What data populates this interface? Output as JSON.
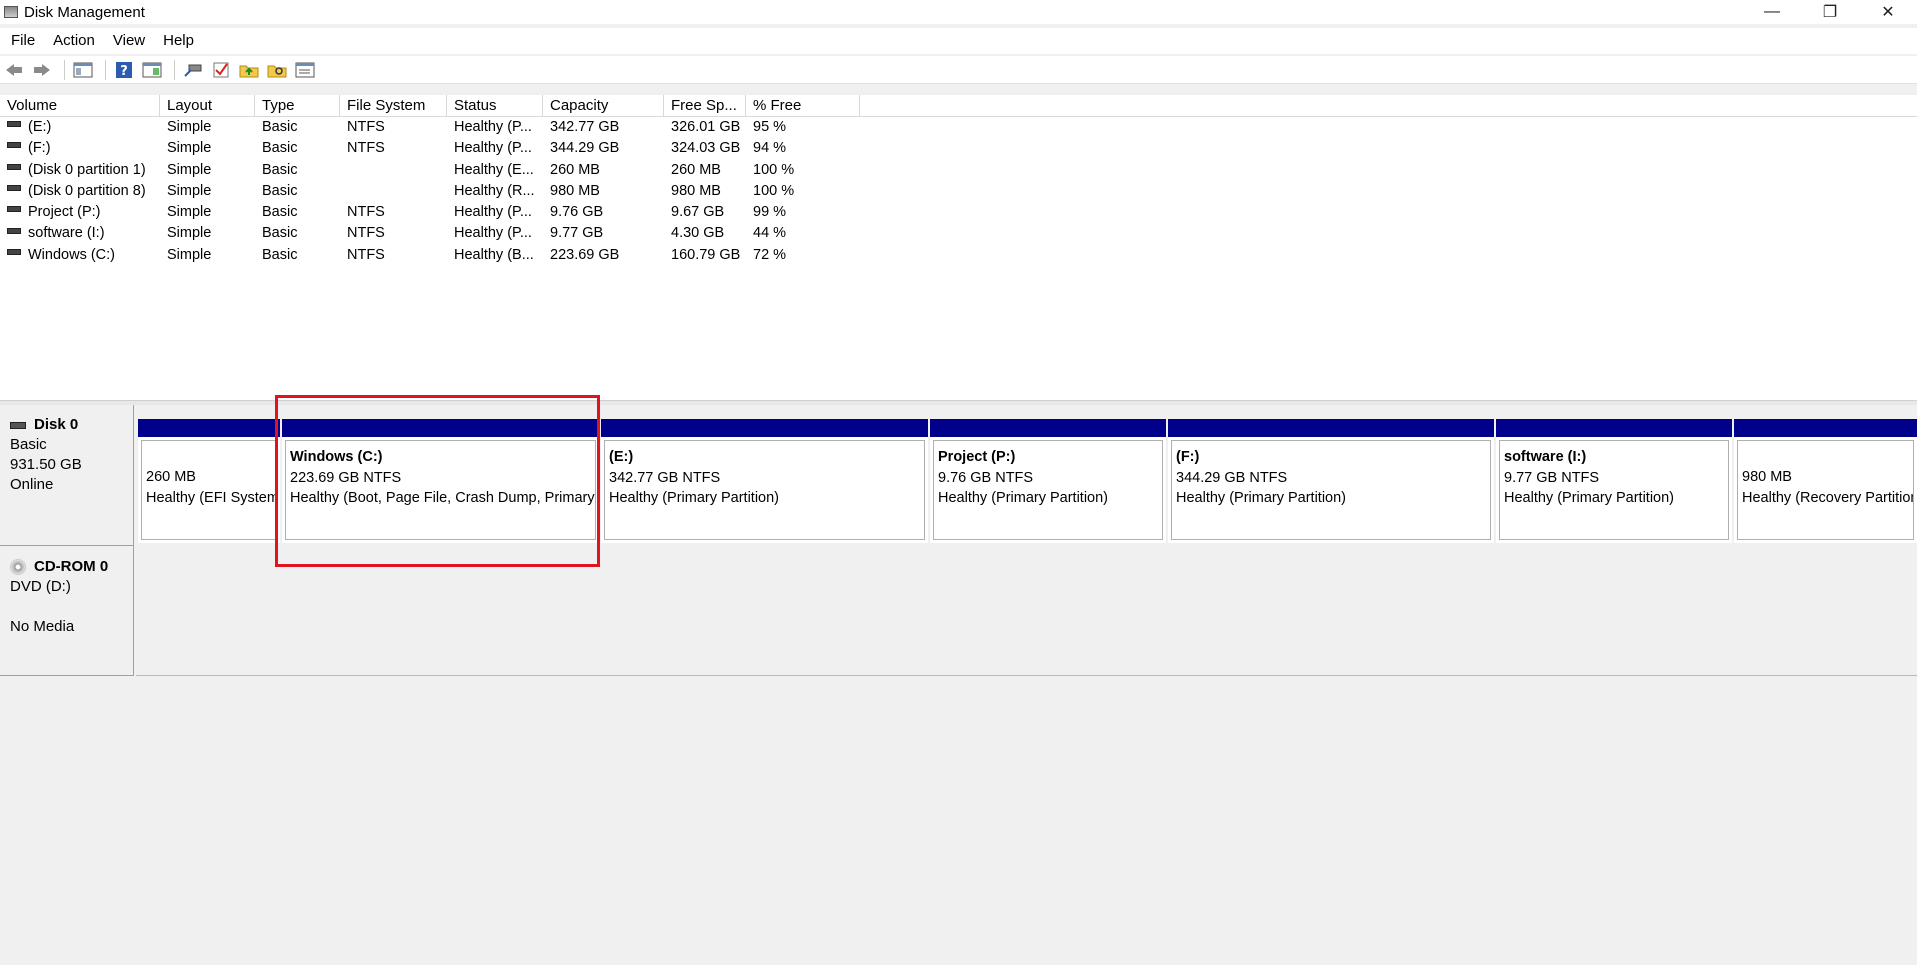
{
  "window": {
    "title": "Disk Management",
    "controls": [
      "—",
      "❐",
      "✕"
    ]
  },
  "menu": [
    "File",
    "Action",
    "View",
    "Help"
  ],
  "toolbar_icons": [
    "back-icon",
    "forward-icon",
    "console-tree-icon",
    "help-icon",
    "properties-icon",
    "connect-icon",
    "check-icon",
    "folder-up-icon",
    "folder-search-icon",
    "list-icon"
  ],
  "columns": [
    "Volume",
    "Layout",
    "Type",
    "File System",
    "Status",
    "Capacity",
    "Free Sp...",
    "% Free"
  ],
  "volumes": [
    [
      "(E:)",
      "Simple",
      "Basic",
      "NTFS",
      "Healthy (P...",
      "342.77 GB",
      "326.01 GB",
      "95 %"
    ],
    [
      "(F:)",
      "Simple",
      "Basic",
      "NTFS",
      "Healthy (P...",
      "344.29 GB",
      "324.03 GB",
      "94 %"
    ],
    [
      "(Disk 0 partition 1)",
      "Simple",
      "Basic",
      "",
      "Healthy (E...",
      "260 MB",
      "260 MB",
      "100 %"
    ],
    [
      "(Disk 0 partition 8)",
      "Simple",
      "Basic",
      "",
      "Healthy (R...",
      "980 MB",
      "980 MB",
      "100 %"
    ],
    [
      "Project (P:)",
      "Simple",
      "Basic",
      "NTFS",
      "Healthy (P...",
      "9.76 GB",
      "9.67 GB",
      "99 %"
    ],
    [
      "software (I:)",
      "Simple",
      "Basic",
      "NTFS",
      "Healthy (P...",
      "9.77 GB",
      "4.30 GB",
      "44 %"
    ],
    [
      "Windows (C:)",
      "Simple",
      "Basic",
      "NTFS",
      "Healthy (B...",
      "223.69 GB",
      "160.79 GB",
      "72 %"
    ]
  ],
  "disk0": {
    "name": "Disk 0",
    "type": "Basic",
    "size": "931.50 GB",
    "state": "Online",
    "partitions": [
      {
        "name": "",
        "size": "260 MB",
        "status": "Healthy (EFI System Partition)"
      },
      {
        "name": "Windows  (C:)",
        "size": "223.69 GB NTFS",
        "status": "Healthy (Boot, Page File, Crash Dump, Primary Partition)"
      },
      {
        "name": "(E:)",
        "size": "342.77 GB NTFS",
        "status": "Healthy (Primary Partition)"
      },
      {
        "name": "Project  (P:)",
        "size": "9.76 GB NTFS",
        "status": "Healthy (Primary Partition)"
      },
      {
        "name": "(F:)",
        "size": "344.29 GB NTFS",
        "status": "Healthy (Primary Partition)"
      },
      {
        "name": "software  (I:)",
        "size": "9.77 GB NTFS",
        "status": "Healthy (Primary Partition)"
      },
      {
        "name": "",
        "size": "980 MB",
        "status": "Healthy (Recovery Partition)"
      }
    ]
  },
  "cdrom0": {
    "name": "CD-ROM 0",
    "type": "DVD (D:)",
    "media": "No Media"
  },
  "colors": {
    "partition_bar": "#00008b",
    "highlight": "#e0141e"
  }
}
